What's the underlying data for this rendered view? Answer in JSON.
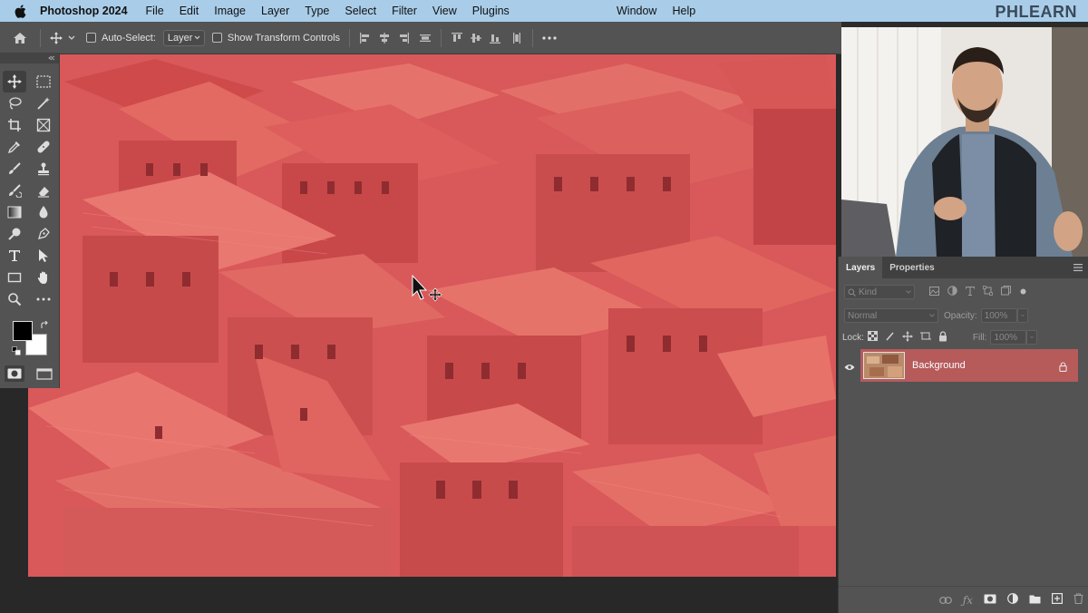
{
  "menubar": {
    "app_name": "Photoshop 2024",
    "items": [
      "File",
      "Edit",
      "Image",
      "Layer",
      "Type",
      "Select",
      "Filter",
      "View",
      "Plugins"
    ],
    "right_items": [
      "Window",
      "Help"
    ],
    "brand": "PHLEARN"
  },
  "options_bar": {
    "auto_select_label": "Auto-Select:",
    "auto_select_value": "Layer",
    "transform_controls_label": "Show Transform Controls"
  },
  "tools": [
    "move-tool",
    "marquee-tool",
    "lasso-tool",
    "magic-wand-tool",
    "crop-tool",
    "frame-tool",
    "eyedropper-tool",
    "healing-brush-tool",
    "brush-tool",
    "clone-stamp-tool",
    "history-brush-tool",
    "eraser-tool",
    "gradient-tool",
    "blur-tool",
    "dodge-tool",
    "pen-tool",
    "type-tool",
    "path-selection-tool",
    "rectangle-tool",
    "hand-tool",
    "zoom-tool",
    "more-tools"
  ],
  "colors": {
    "foreground": "#000000",
    "background": "#ffffff",
    "photo_tint": "#e0585a",
    "selected_layer": "#b65a5a",
    "menubar": "#a9cde9"
  },
  "layers_panel": {
    "tabs": [
      "Layers",
      "Properties"
    ],
    "filter_placeholder": "Kind",
    "blend_mode": "Normal",
    "opacity_label": "Opacity:",
    "opacity_value": "100%",
    "lock_label": "Lock:",
    "fill_label": "Fill:",
    "fill_value": "100%",
    "layers": [
      {
        "name": "Background",
        "visible": true,
        "locked": true,
        "selected": true
      }
    ]
  }
}
